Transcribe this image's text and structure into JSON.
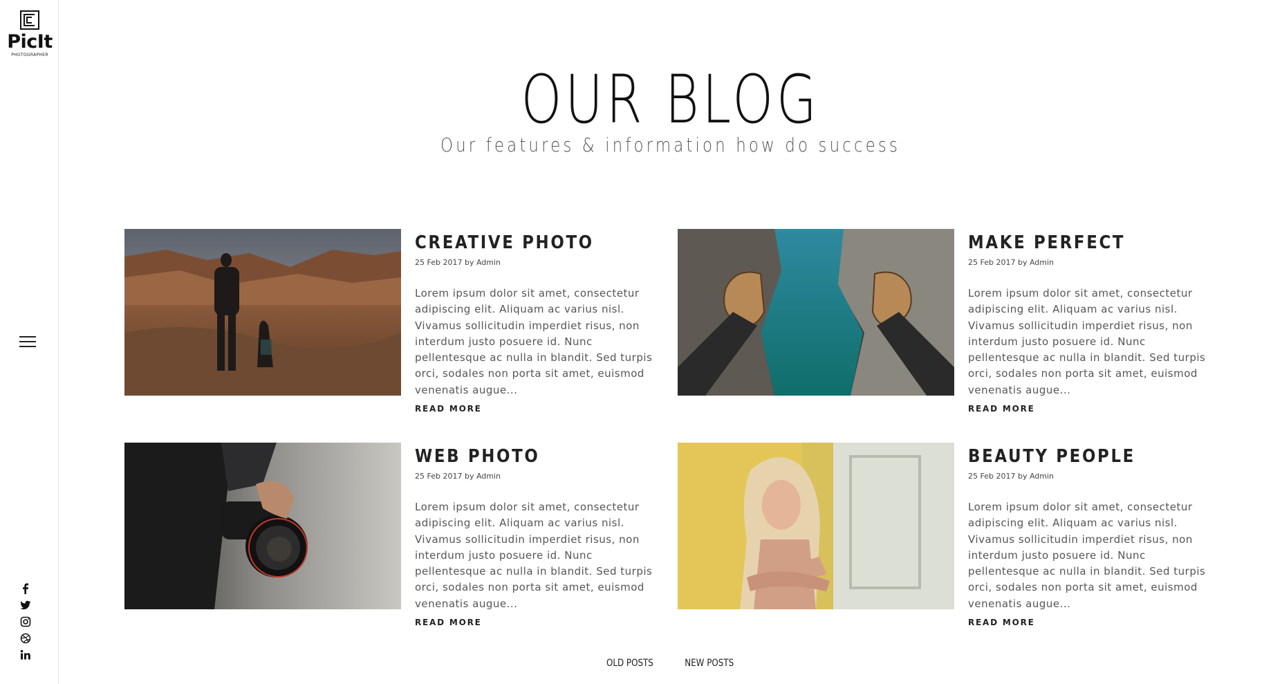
{
  "brand": {
    "name": "PicIt",
    "tagline": "PHOTOGRAPHER"
  },
  "sidebar": {
    "menu_icon": "hamburger-menu-icon",
    "socials": [
      {
        "name": "facebook-icon"
      },
      {
        "name": "twitter-icon"
      },
      {
        "name": "instagram-icon"
      },
      {
        "name": "dribbble-icon"
      },
      {
        "name": "linkedin-icon"
      }
    ]
  },
  "header": {
    "title": "OUR BLOG",
    "subtitle": "Our features & information how do success"
  },
  "posts": [
    {
      "title": "CREATIVE PHOTO",
      "meta": "25 Feb 2017 by Admin",
      "excerpt": "Lorem ipsum dolor sit amet, consectetur adipiscing elit. Aliquam ac varius nisl. Vivamus sollicitudin imperdiet risus, non interdum justo posuere id. Nunc pellentesque ac nulla in blandit. Sed turpis orci, sodales non porta sit amet, euismod venenatis augue...",
      "read_more": "READ MORE",
      "image": "canyon-hiker-with-dog"
    },
    {
      "title": "MAKE PERFECT",
      "meta": "25 Feb 2017 by Admin",
      "excerpt": "Lorem ipsum dolor sit amet, consectetur adipiscing elit. Aliquam ac varius nisl. Vivamus sollicitudin imperdiet risus, non interdum justo posuere id. Nunc pellentesque ac nulla in blandit. Sed turpis orci, sodales non porta sit amet, euismod venenatis augue...",
      "read_more": "READ MORE",
      "image": "boots-over-river-gorge"
    },
    {
      "title": "WEB PHOTO",
      "meta": "25 Feb 2017 by Admin",
      "excerpt": "Lorem ipsum dolor sit amet, consectetur adipiscing elit. Aliquam ac varius nisl. Vivamus sollicitudin imperdiet risus, non interdum justo posuere id. Nunc pellentesque ac nulla in blandit. Sed turpis orci, sodales non porta sit amet, euismod venenatis augue...",
      "read_more": "READ MORE",
      "image": "hand-holding-camera"
    },
    {
      "title": "BEAUTY PEOPLE",
      "meta": "25 Feb 2017 by Admin",
      "excerpt": "Lorem ipsum dolor sit amet, consectetur adipiscing elit. Aliquam ac varius nisl. Vivamus sollicitudin imperdiet risus, non interdum justo posuere id. Nunc pellentesque ac nulla in blandit. Sed turpis orci, sodales non porta sit amet, euismod venenatis augue...",
      "read_more": "READ MORE",
      "image": "woman-portrait-yellow-wall"
    }
  ],
  "pagination": {
    "old_label": "OLD POSTS",
    "new_label": "NEW POSTS"
  }
}
